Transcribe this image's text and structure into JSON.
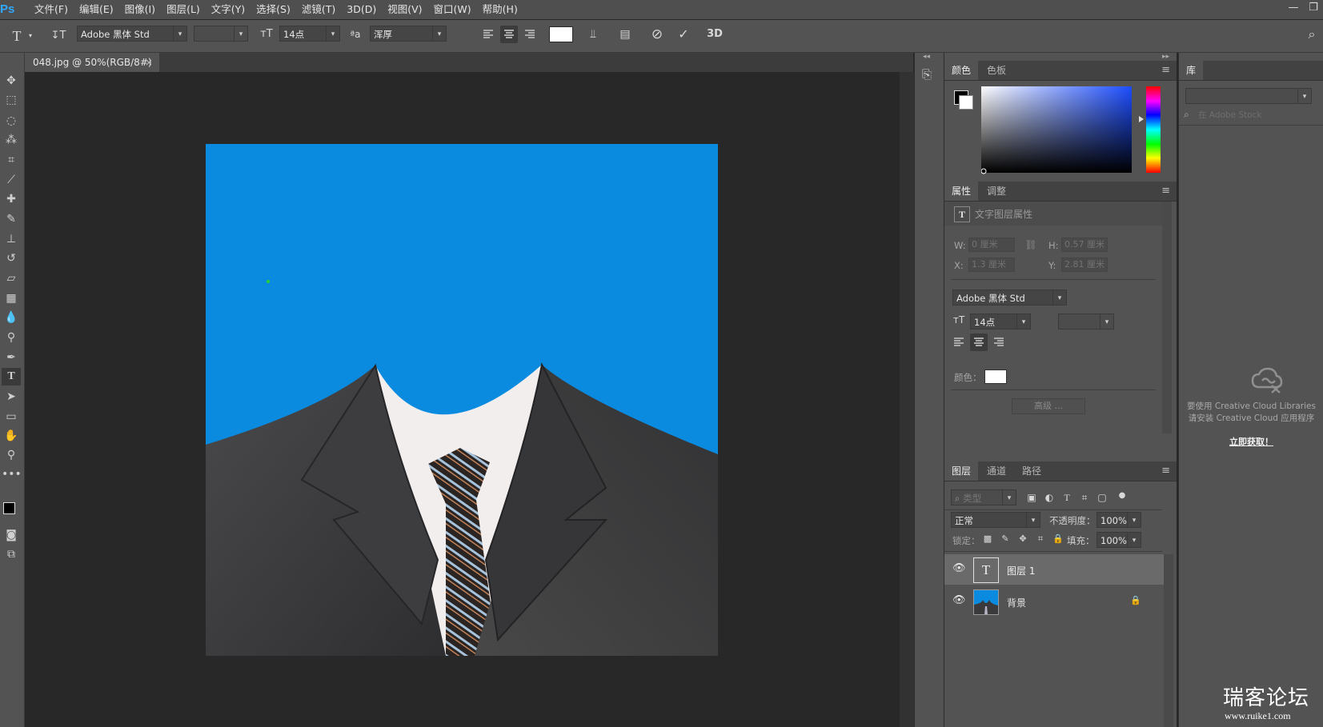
{
  "app": {
    "logo": "Ps"
  },
  "menu": [
    "文件(F)",
    "编辑(E)",
    "图像(I)",
    "图层(L)",
    "文字(Y)",
    "选择(S)",
    "滤镜(T)",
    "3D(D)",
    "视图(V)",
    "窗口(W)",
    "帮助(H)"
  ],
  "window_controls": {
    "minimize": "—",
    "restore": "❐"
  },
  "options_bar": {
    "tool_glyph": "T",
    "orient_glyph": "↧T",
    "font_family": "Adobe 黑体 Std",
    "font_style": "",
    "font_size_glyph": "тT",
    "font_size": "14点",
    "aa_glyph": "ªa",
    "antialias": "浑厚",
    "text_color": "#ffffff",
    "three_d": "3D",
    "search_glyph": "⌕"
  },
  "document": {
    "tab_title": "048.jpg @ 50%(RGB/8#)",
    "tab_close": "×",
    "background_color": "#0a8be0"
  },
  "color_panel": {
    "tabs": [
      "颜色",
      "色板"
    ],
    "foreground": "#000000",
    "background": "#ffffff"
  },
  "properties_panel": {
    "tabs": [
      "属性",
      "调整"
    ],
    "title": "文字图层属性",
    "w_label": "W:",
    "w_value": "0 厘米",
    "h_label": "H:",
    "h_value": "0.57 厘米",
    "x_label": "X:",
    "x_value": "1.3 厘米",
    "y_label": "Y:",
    "y_value": "2.81 厘米",
    "font": "Adobe 黑体 Std",
    "size": "14点",
    "color_label": "颜色：",
    "color": "#ffffff",
    "advanced_button": "高级 ..."
  },
  "layers_panel": {
    "tabs": [
      "图层",
      "通道",
      "路径"
    ],
    "filter_placeholder": "类型",
    "blend_mode": "正常",
    "opacity_label": "不透明度：",
    "opacity": "100%",
    "lock_label": "锁定：",
    "fill_label": "填充：",
    "fill": "100%",
    "layers": [
      {
        "name": "图层 1",
        "type": "text",
        "thumb_glyph": "T",
        "selected": true
      },
      {
        "name": "背景",
        "type": "image",
        "locked": true,
        "selected": false
      }
    ]
  },
  "library_panel": {
    "tab": "库",
    "search_placeholder": "在 Adobe Stock",
    "message_line1": "要使用 Creative Cloud Libraries",
    "message_line2": "请安装 Creative Cloud 应用程序",
    "link": "立即获取！"
  },
  "watermark": {
    "cn": "瑞客论坛",
    "url": "www.ruike1.com"
  }
}
